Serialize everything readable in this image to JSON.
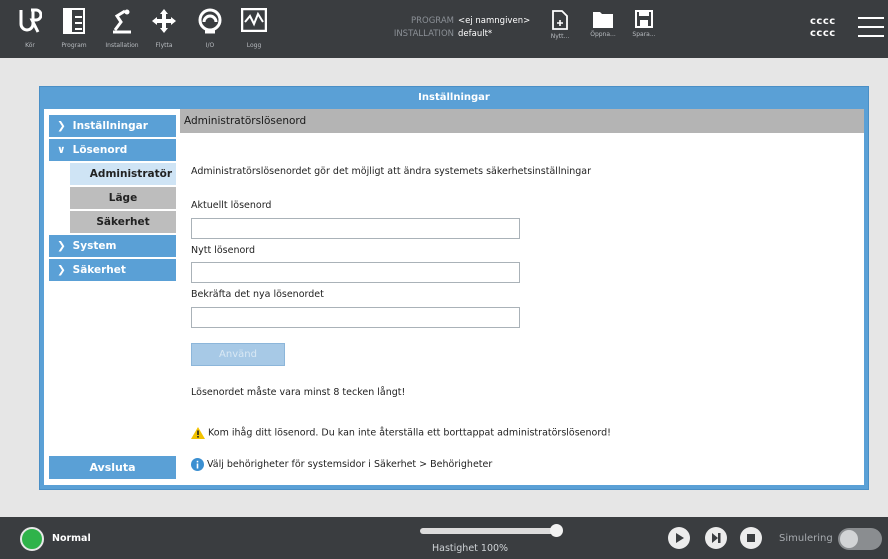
{
  "topbar": {
    "nav_buttons": [
      {
        "label": "Kör",
        "icon": "ur-logo-icon"
      },
      {
        "label": "Program",
        "icon": "program-icon"
      },
      {
        "label": "Installation",
        "icon": "installation-icon"
      },
      {
        "label": "Flytta",
        "icon": "move-icon"
      },
      {
        "label": "I/O",
        "icon": "io-icon"
      },
      {
        "label": "Logg",
        "icon": "log-icon"
      }
    ],
    "program_label": "PROGRAM",
    "program_value": "<ej namngiven>",
    "installation_label": "INSTALLATION",
    "installation_value": "default*",
    "file_buttons": [
      {
        "label": "Nytt...",
        "icon": "new-file-icon"
      },
      {
        "label": "Öppna...",
        "icon": "open-folder-icon"
      },
      {
        "label": "Spara...",
        "icon": "save-icon"
      }
    ],
    "user_line1": "cccc",
    "user_line2": "cccc"
  },
  "dialog": {
    "title": "Inställningar",
    "sidebar": {
      "items": [
        {
          "label": "Inställningar",
          "expanded": false
        },
        {
          "label": "Lösenord",
          "expanded": true
        },
        {
          "label": "System",
          "expanded": false
        },
        {
          "label": "Säkerhet",
          "expanded": false
        }
      ],
      "sub_items": [
        {
          "label": "Administratör",
          "active": true
        },
        {
          "label": "Läge",
          "active": false
        },
        {
          "label": "Säkerhet",
          "active": false
        }
      ],
      "exit_label": "Avsluta"
    },
    "content": {
      "heading": "Administratörslösenord",
      "description": "Administratörslösenordet gör det möjligt att ändra systemets säkerhetsinställningar",
      "current_label": "Aktuellt lösenord",
      "current_value": "",
      "new_label": "Nytt lösenord",
      "new_value": "",
      "confirm_label": "Bekräfta det nya lösenordet",
      "confirm_value": "",
      "apply_label": "Använd",
      "min_length_note": "Lösenordet måste vara minst 8 tecken långt!",
      "warning_text": "Kom ihåg ditt lösenord. Du kan inte återställa ett borttappat administratörslösenord!",
      "info_text": "Välj behörigheter för systemsidor i Säkerhet > Behörigheter"
    }
  },
  "bottombar": {
    "status": "Normal",
    "status_color": "#2fb34a",
    "speed_label": "Hastighet 100%",
    "speed_fraction": 1.0,
    "simulation_label": "Simulering",
    "simulation_on": false
  },
  "colors": {
    "accent": "#5aa0d6",
    "topbar": "#3a3d40",
    "warning": "#f2c200",
    "info": "#3b8fd1"
  }
}
